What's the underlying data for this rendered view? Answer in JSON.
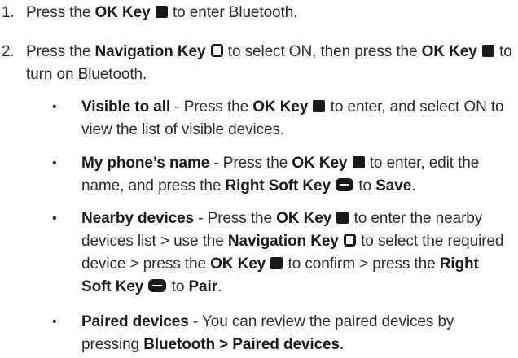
{
  "steps": [
    {
      "number": "1.",
      "parts": [
        "Press the ",
        "OK Key",
        " to enter Bluetooth."
      ]
    },
    {
      "number": "2.",
      "parts": [
        "Press the ",
        "Navigation Key",
        " to select ON, then press the ",
        "OK Key",
        " to turn on Bluetooth."
      ]
    }
  ],
  "bullets": [
    {
      "title": "Visible to all",
      "parts": [
        " - Press the ",
        "OK Key",
        " to enter, and select ON to view the list of visible devices."
      ]
    },
    {
      "title": "My phone’s name",
      "parts": [
        " - Press the ",
        "OK Key",
        " to enter, edit the name, and press the ",
        "Right Soft Key",
        " to ",
        "Save",
        "."
      ]
    },
    {
      "title": "Nearby devices",
      "parts": [
        " - Press the ",
        "OK Key",
        " to enter the nearby devices list > use the ",
        "Navigation Key",
        " to select the required device > press the ",
        "OK Key",
        " to confirm > press the ",
        "Right Soft Key",
        " to ",
        "Pair",
        "."
      ]
    },
    {
      "title": "Paired devices",
      "parts": [
        " - You can review the paired devices by pressing ",
        "Bluetooth > Paired devices",
        "."
      ]
    }
  ],
  "bullet_symbol": "•",
  "icons": {
    "ok_key": "ok-key-icon",
    "navigation_key": "navigation-key-icon",
    "right_soft_key": "right-soft-key-icon"
  }
}
